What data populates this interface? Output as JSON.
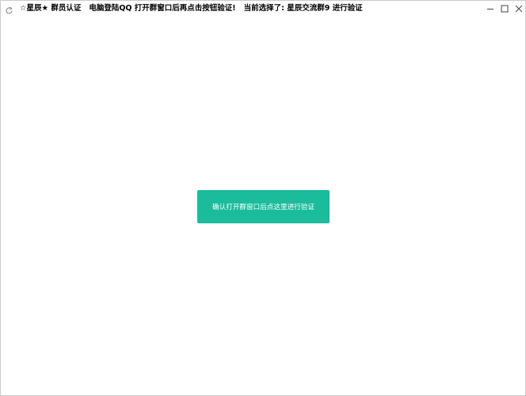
{
  "window": {
    "title_segments": [
      "☆星辰★ 群员认证",
      "电脑登陆QQ 打开群窗口后再点击按钮验证!",
      "当前选择了: 星辰交流群9 进行验证"
    ],
    "icons": {
      "app": "refresh-icon",
      "minimize": "minimize-icon",
      "maximize": "maximize-icon",
      "close": "close-icon"
    }
  },
  "main": {
    "verify_button_label": "确认打开群窗口后点这里进行验证"
  },
  "colors": {
    "button_bg": "#1abc9c",
    "button_text": "#ffffff",
    "window_border": "#c9c9c9"
  }
}
